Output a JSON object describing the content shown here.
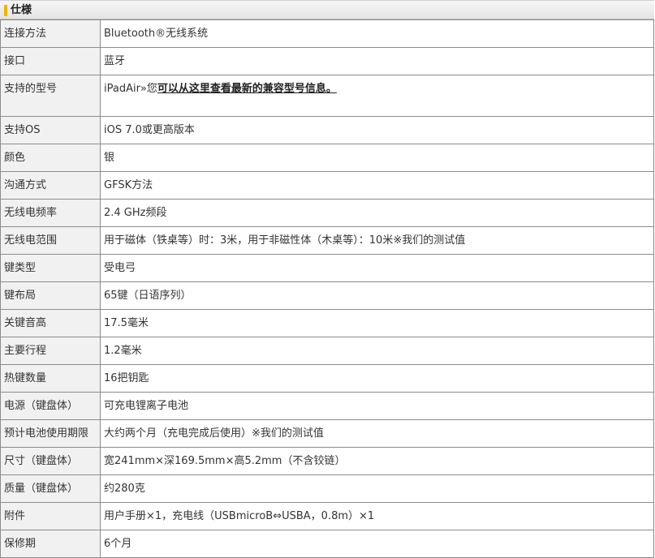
{
  "section": {
    "title": "仕様"
  },
  "rows": [
    {
      "label": "连接方法",
      "value": "Bluetooth®无线系统"
    },
    {
      "label": "接口",
      "value": "蓝牙"
    },
    {
      "label": "支持的型号",
      "value": "iPadAir»您",
      "link": "可以从这里查看最新的兼容型号信息。"
    },
    {
      "label": "支持OS",
      "value": "iOS 7.0或更高版本"
    },
    {
      "label": "颜色",
      "value": "银"
    },
    {
      "label": "沟通方式",
      "value": "GFSK方法"
    },
    {
      "label": "无线电频率",
      "value": "2.4 GHz频段"
    },
    {
      "label": "无线电范围",
      "value": "用于磁体（铁桌等）时：3米，用于非磁性体（木桌等）：10米※我们的测试值"
    },
    {
      "label": "键类型",
      "value": "受电弓"
    },
    {
      "label": "键布局",
      "value": "65键（日语序列）"
    },
    {
      "label": "关键音高",
      "value": "17.5毫米"
    },
    {
      "label": "主要行程",
      "value": "1.2毫米"
    },
    {
      "label": "热键数量",
      "value": "16把钥匙"
    },
    {
      "label": "电源（键盘体）",
      "value": "可充电锂离子电池"
    },
    {
      "label": "预计电池使用期限",
      "value": "大约两个月（充电完成后使用）※我们的测试值"
    },
    {
      "label": "尺寸（键盘体）",
      "value": "宽241mm×深169.5mm×高5.2mm（不含铰链）"
    },
    {
      "label": "质量（键盘体）",
      "value": "约280克"
    },
    {
      "label": "附件",
      "value": "用户手册×1，充电线（USBmicroB⇔USBA，0.8m）×1"
    },
    {
      "label": "保修期",
      "value": "6个月"
    }
  ]
}
